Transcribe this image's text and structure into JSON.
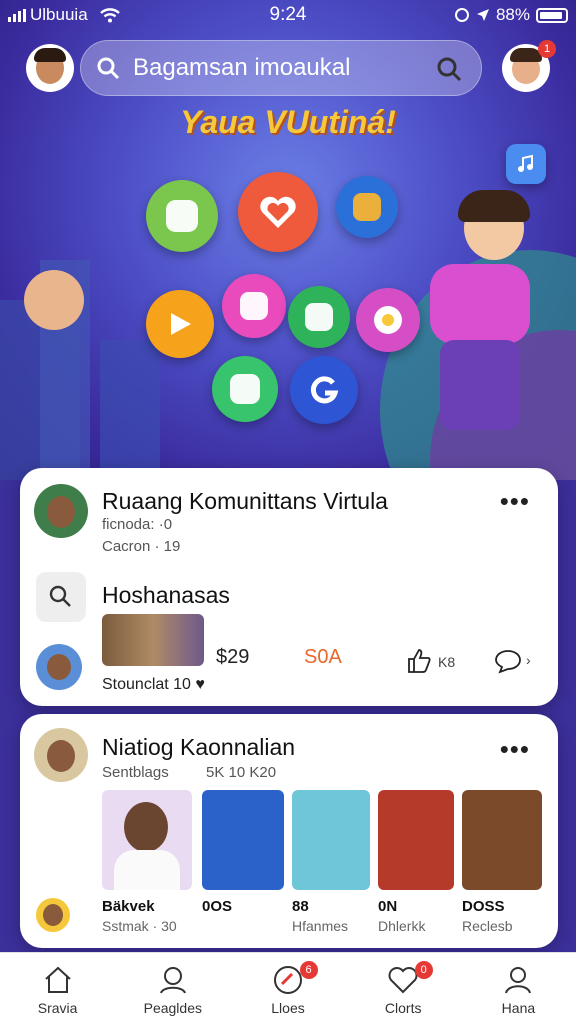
{
  "status_bar": {
    "carrier": "Ulbuuia",
    "time": "9:24",
    "battery": "88%"
  },
  "search": {
    "value": "Bagamsan imoaukal"
  },
  "profile_badge_count": "1",
  "hero": {
    "headline": "Yaua VUutiná!"
  },
  "colors": {
    "accent": "#f6c83a",
    "badge": "#e53935",
    "hero": "#4e50c8"
  },
  "card1": {
    "title": "Ruaang Komunittans Virtula",
    "meta1": "ficnoda: ·0",
    "meta2": "Cacron · 19",
    "search_title": "Hoshanasas",
    "price1": "$29",
    "price2": "S0A",
    "likes": "K8",
    "footer": "Stounclat 10 ♥"
  },
  "card2": {
    "title": "Niatiog Kaonnalian",
    "sub_left": "Sentblags",
    "sub_right": "5K 10 K20",
    "items": [
      {
        "cap1": "Bäkvek",
        "cap2": "Sstmak · 30"
      },
      {
        "cap1": "0OS",
        "cap2": ""
      },
      {
        "cap1": "88",
        "cap2": "Hfanmes"
      },
      {
        "cap1": "0N",
        "cap2": "Dhlerkk"
      },
      {
        "cap1": "DOSS",
        "cap2": "Reclesb"
      }
    ]
  },
  "tabs": [
    {
      "label": "Sravia",
      "icon": "home-icon",
      "badge": ""
    },
    {
      "label": "Peagldes",
      "icon": "people-icon",
      "badge": ""
    },
    {
      "label": "Lloes",
      "icon": "heart-icon",
      "badge": "6"
    },
    {
      "label": "Clorts",
      "icon": "chat-icon",
      "badge": "0"
    },
    {
      "label": "Hana",
      "icon": "profile-icon",
      "badge": ""
    }
  ]
}
